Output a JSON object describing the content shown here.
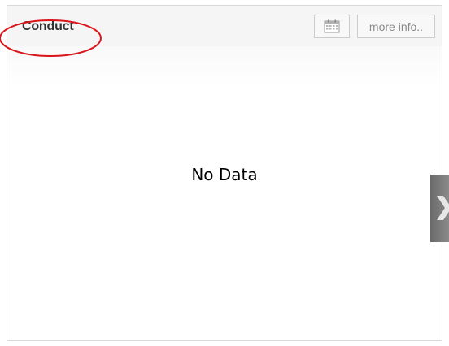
{
  "widget": {
    "title": "Conduct",
    "more_info_label": "more info..",
    "empty_message": "No Data"
  },
  "annotation": {
    "highlight_color": "#d9141b"
  },
  "icons": {
    "calendar": "calendar-icon",
    "side_arrow": "chevron-right-icon"
  }
}
